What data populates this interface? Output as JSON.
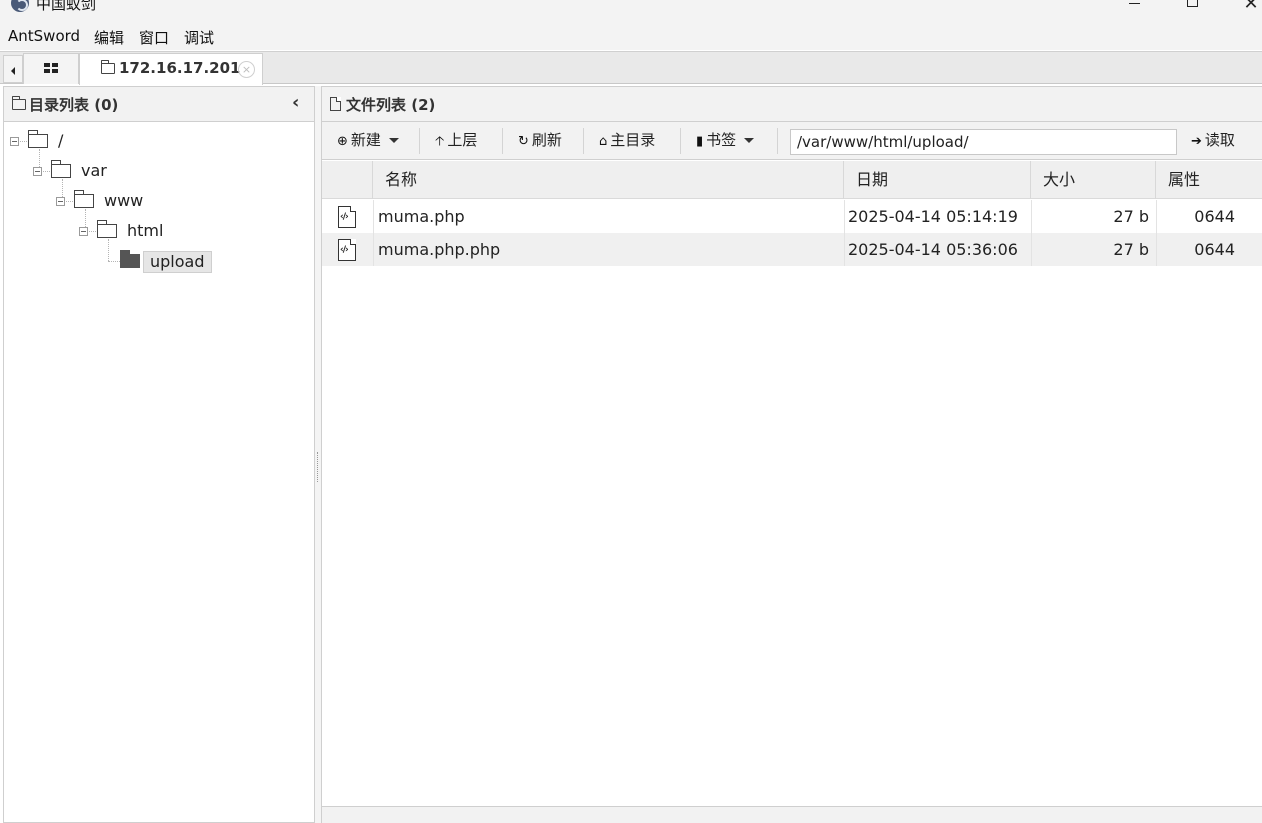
{
  "window": {
    "title": "中国蚁剑",
    "close_glyph": "✕"
  },
  "menu": [
    "AntSword",
    "编辑",
    "窗口",
    "调试"
  ],
  "tabs": {
    "session_label": "172.16.17.201",
    "close_glyph": "×"
  },
  "dir_panel": {
    "title": "目录列表 (0)",
    "collapse_glyph": "‹",
    "tree": [
      {
        "label": "/",
        "depth": 0
      },
      {
        "label": "var",
        "depth": 1
      },
      {
        "label": "www",
        "depth": 2
      },
      {
        "label": "html",
        "depth": 3
      },
      {
        "label": "upload",
        "depth": 4,
        "selected": true
      }
    ]
  },
  "file_panel": {
    "title": "文件列表 (2)",
    "toolbar": {
      "new_label": "新建",
      "up_label": "上层",
      "refresh_label": "刷新",
      "home_label": "主目录",
      "bookmark_label": "书签",
      "path_value": "/var/www/html/upload/",
      "read_label": "读取"
    },
    "columns": [
      "名称",
      "日期",
      "大小",
      "属性"
    ],
    "rows": [
      {
        "name": "muma.php",
        "date": "2025-04-14 05:14:19",
        "size": "27 b",
        "attr": "0644"
      },
      {
        "name": "muma.php.php",
        "date": "2025-04-14 05:36:06",
        "size": "27 b",
        "attr": "0644"
      }
    ],
    "file_icon_glyph": "‹/›"
  }
}
